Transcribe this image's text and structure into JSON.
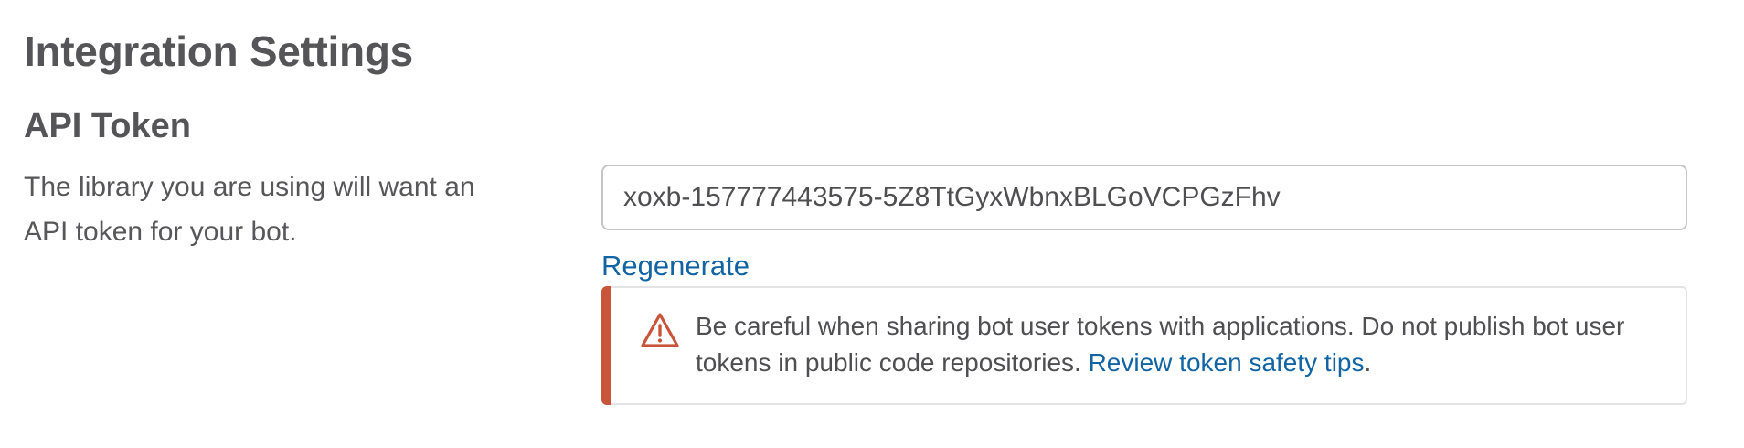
{
  "page": {
    "title": "Integration Settings"
  },
  "api_token": {
    "heading": "API Token",
    "description": "The library you are using will want an API token for your bot.",
    "token_value": "xoxb-157777443575-5Z8TtGyxWbnxBLGoVCPGzFhv",
    "regenerate_label": "Regenerate"
  },
  "warning": {
    "icon": "warning-triangle-icon",
    "text": "Be careful when sharing bot user tokens with applications. Do not publish bot user tokens in public code repositories. ",
    "link_label": "Review token safety tips",
    "trailing": "."
  },
  "colors": {
    "link": "#1264a3",
    "warning_accent": "#c8553a",
    "heading_text": "#555558",
    "body_text": "#4f4f52"
  }
}
